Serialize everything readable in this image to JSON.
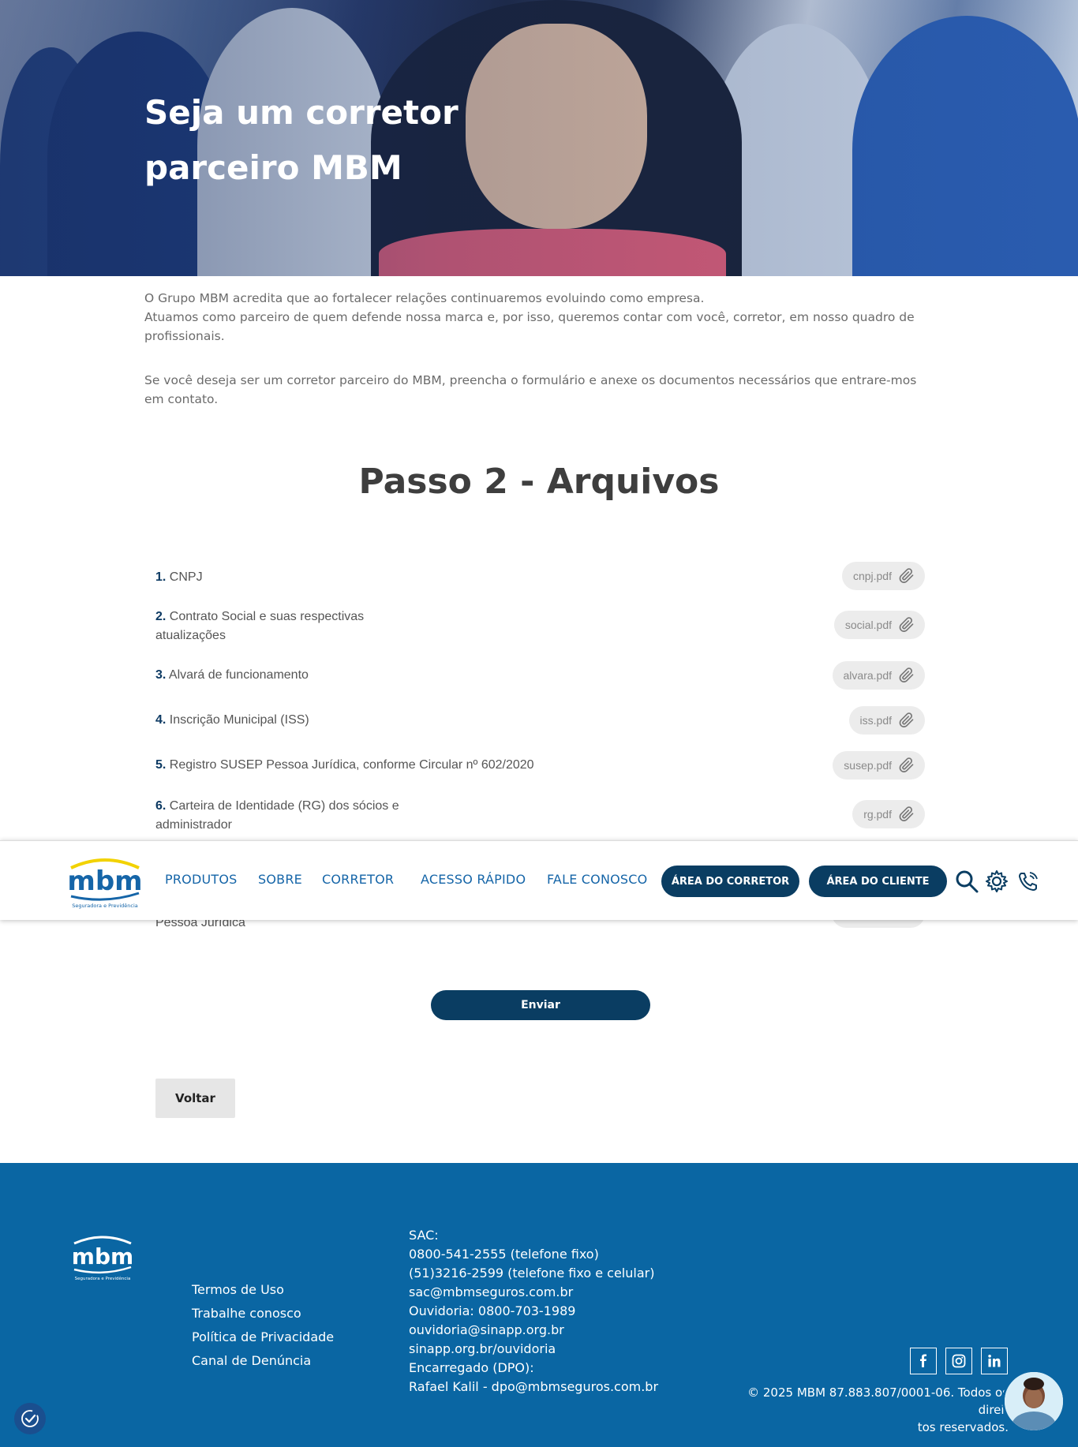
{
  "hero": {
    "title": "Seja um corretor parceiro MBM"
  },
  "intro": {
    "paragraph1_line1": "O Grupo MBM acredita que ao fortalecer relações continuaremos evoluindo como empresa.",
    "paragraph1_line2": "Atuamos como parceiro de quem defende nossa marca e, por isso, queremos contar com você, corretor, em nosso quadro de profissionais.",
    "paragraph2": "Se você deseja ser um corretor parceiro do MBM, preencha o formulário e anexe os documentos necessários que entrare-mos em contato."
  },
  "step": {
    "title": "Passo 2 - Arquivos"
  },
  "files": [
    {
      "num": "1.",
      "label": "CNPJ",
      "file": "cnpj.pdf"
    },
    {
      "num": "2.",
      "label": "Contrato Social e suas respectivas atualizações",
      "file": "social.pdf"
    },
    {
      "num": "3.",
      "label": "Alvará de funcionamento",
      "file": "alvara.pdf"
    },
    {
      "num": "4.",
      "label": "Inscrição Municipal (ISS)",
      "file": "iss.pdf"
    },
    {
      "num": "5.",
      "label": "Registro SUSEP Pessoa Jurídica, conforme Circular nº 602/2020",
      "file": "susep.pdf"
    },
    {
      "num": "6.",
      "label": "Carteira de Identidade (RG) dos sócios e administrador",
      "file": "rg.pdf"
    }
  ],
  "partial_row_text": "Pessoa Jurídica",
  "nav": {
    "logo_text": "mbm",
    "logo_subtitle": "Seguradora e Previdência",
    "items": [
      "PRODUTOS",
      "SOBRE",
      "CORRETOR",
      "ACESSO RÁPIDO",
      "FALE CONOSCO"
    ],
    "btn_corretor": "ÁREA DO CORRETOR",
    "btn_cliente": "ÁREA DO CLIENTE",
    "icons": [
      "search-icon",
      "gear-icon",
      "phone-icon"
    ]
  },
  "actions": {
    "enviar": "Enviar",
    "voltar": "Voltar"
  },
  "footer": {
    "logo_text": "mbm",
    "logo_subtitle": "Seguradora e Previdência",
    "links": [
      "Termos de Uso",
      "Trabalhe conosco",
      "Política de Privacidade",
      "Canal de Denúncia"
    ],
    "contact": [
      "SAC:",
      "0800-541-2555 (telefone fixo)",
      "(51)3216-2599 (telefone fixo e celular)",
      "sac@mbmseguros.com.br",
      "Ouvidoria: 0800-703-1989",
      "ouvidoria@sinapp.org.br",
      "sinapp.org.br/ouvidoria",
      "Encarregado (DPO):",
      "Rafael Kalil - dpo@mbmseguros.com.br"
    ],
    "social": [
      "facebook-icon",
      "instagram-icon",
      "linkedin-icon"
    ],
    "copyright_line1": "© 2025 MBM 87.883.807/0001-06. Todos os direi-",
    "copyright_line2": "tos reservados."
  },
  "colors": {
    "primary": "#0a3d62",
    "link": "#1565a8",
    "footer": "#0a66a3",
    "accent_yellow": "#f2d200"
  }
}
